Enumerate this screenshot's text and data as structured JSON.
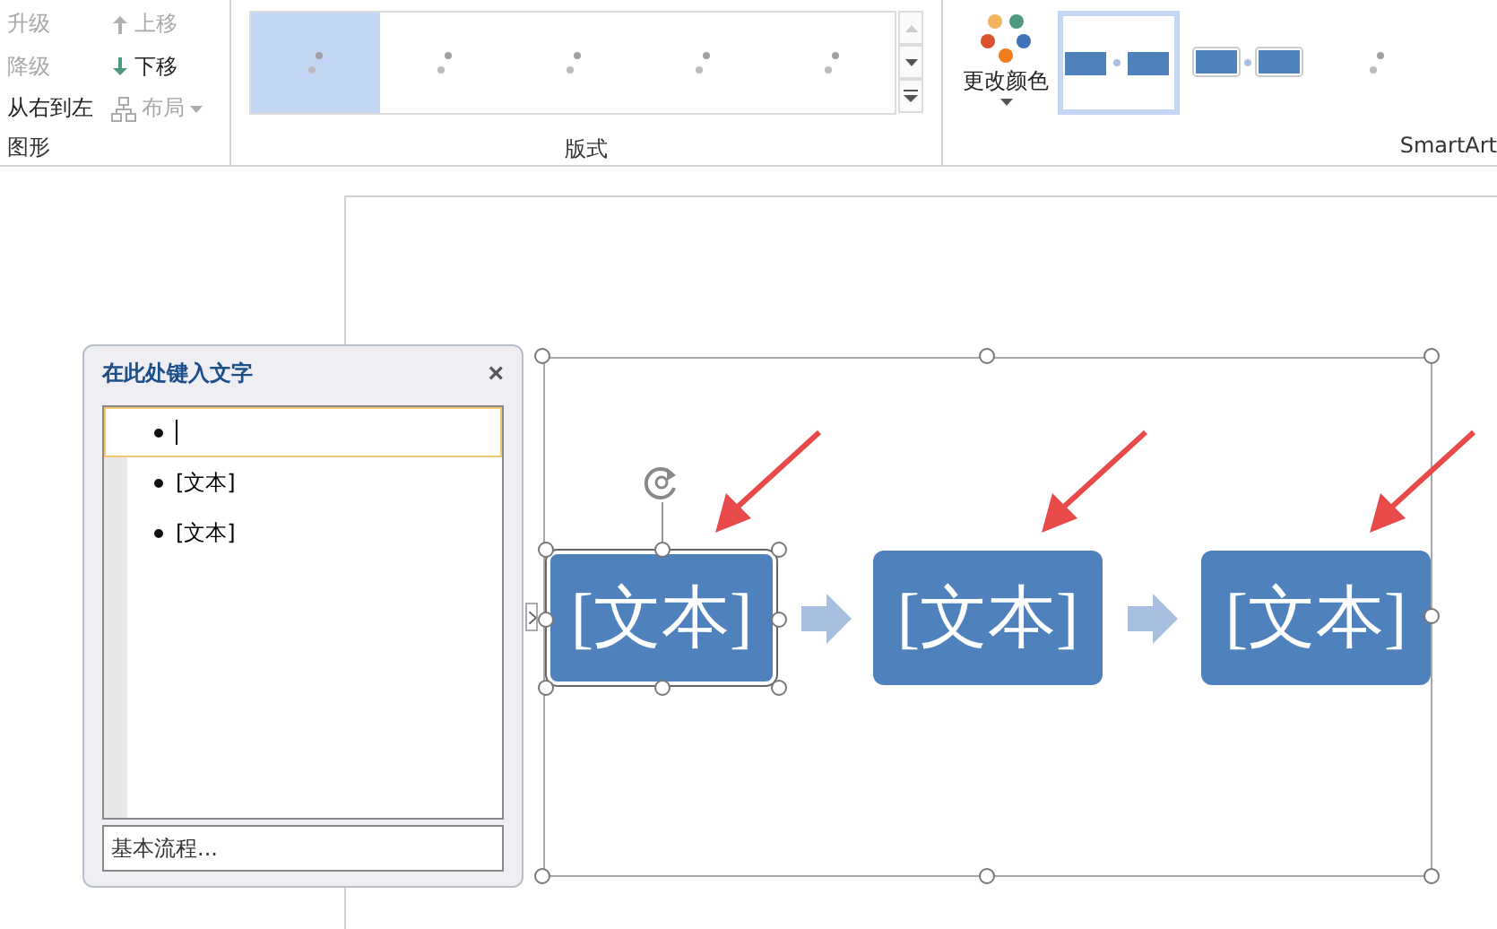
{
  "ribbon": {
    "graphic_group": {
      "label": "图形",
      "buttons": [
        {
          "label": "升级",
          "disabled": true,
          "kind": "text"
        },
        {
          "label": "上移",
          "disabled": true,
          "kind": "up"
        },
        {
          "label": "降级",
          "disabled": true,
          "kind": "text"
        },
        {
          "label": "下移",
          "disabled": false,
          "kind": "down"
        },
        {
          "label": "从右到左",
          "disabled": false,
          "kind": "text"
        },
        {
          "label": "布局",
          "disabled": true,
          "kind": "layout"
        }
      ]
    },
    "layouts_group": {
      "label": "版式",
      "items": [
        {
          "selected": true
        },
        {
          "selected": false
        },
        {
          "selected": false
        },
        {
          "selected": false
        },
        {
          "selected": false
        }
      ]
    },
    "styles_group": {
      "label": "SmartArt",
      "change_colors": "更改颜色",
      "styles": [
        {
          "kind": "flat",
          "selected": true
        },
        {
          "kind": "raised",
          "selected": false
        },
        {
          "kind": "dots",
          "selected": false
        }
      ]
    }
  },
  "text_pane": {
    "title": "在此处键入文字",
    "close": "×",
    "items": [
      {
        "selected": true
      },
      {
        "text": "[文本]",
        "selected": false
      },
      {
        "text": "[文本]",
        "selected": false
      }
    ],
    "footer": "基本流程..."
  },
  "diagram": {
    "shapes": [
      {
        "text": "[文本]",
        "selected": true
      },
      {
        "text": "[文本]",
        "selected": false
      },
      {
        "text": "[文本]",
        "selected": false
      }
    ]
  }
}
